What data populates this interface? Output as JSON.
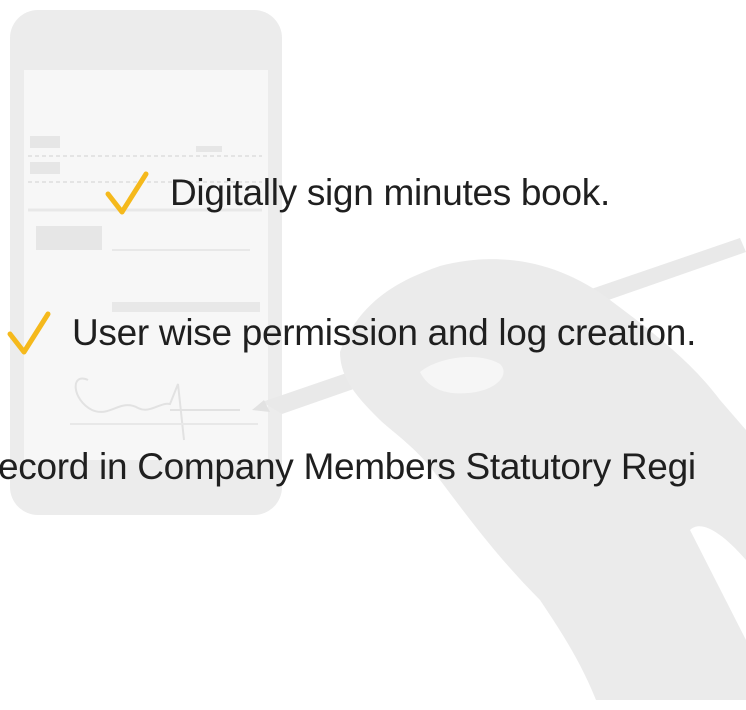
{
  "features": [
    {
      "text": "Digitally sign minutes book.",
      "checked": true
    },
    {
      "text": "User wise permission and log creation.",
      "checked": true
    },
    {
      "text": "ecord in Company Members Statutory Regi",
      "checked": false
    }
  ],
  "colors": {
    "check": "#f5b91c",
    "text": "#1f1f1f",
    "illustration": "#ebebeb",
    "illustration_light": "#f5f5f5"
  },
  "icons": {
    "check": "checkmark-icon",
    "phone": "phone-illustration",
    "hand": "hand-signing-illustration"
  }
}
